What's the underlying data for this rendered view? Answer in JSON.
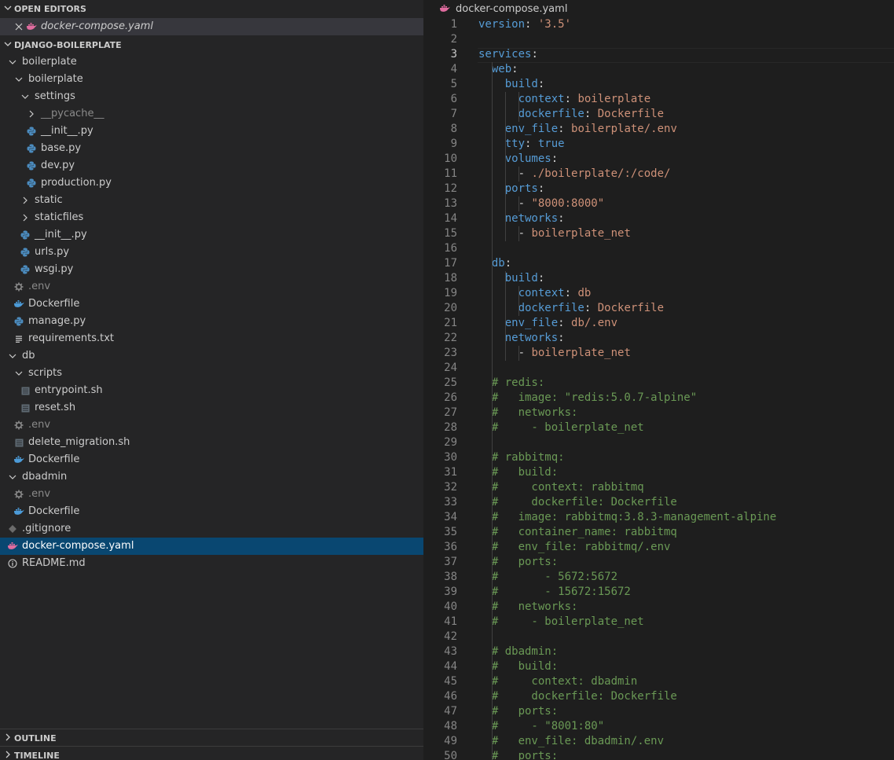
{
  "sidebar": {
    "open_editors_header": "OPEN EDITORS",
    "open_editor_file": "docker-compose.yaml",
    "project_header": "DJANGO-BOILERPLATE",
    "tree": [
      {
        "label": "boilerplate",
        "depth": 0,
        "kind": "folder-open",
        "icon": ""
      },
      {
        "label": "boilerplate",
        "depth": 1,
        "kind": "folder-open",
        "icon": ""
      },
      {
        "label": "settings",
        "depth": 2,
        "kind": "folder-open",
        "icon": ""
      },
      {
        "label": "__pycache__",
        "depth": 3,
        "kind": "folder-closed",
        "icon": "",
        "dim": true
      },
      {
        "label": "__init__.py",
        "depth": 3,
        "kind": "file",
        "icon": "python-icon"
      },
      {
        "label": "base.py",
        "depth": 3,
        "kind": "file",
        "icon": "python-icon"
      },
      {
        "label": "dev.py",
        "depth": 3,
        "kind": "file",
        "icon": "python-icon"
      },
      {
        "label": "production.py",
        "depth": 3,
        "kind": "file",
        "icon": "python-icon"
      },
      {
        "label": "static",
        "depth": 2,
        "kind": "folder-closed",
        "icon": ""
      },
      {
        "label": "staticfiles",
        "depth": 2,
        "kind": "folder-closed",
        "icon": ""
      },
      {
        "label": "__init__.py",
        "depth": 2,
        "kind": "file",
        "icon": "python-icon"
      },
      {
        "label": "urls.py",
        "depth": 2,
        "kind": "file",
        "icon": "python-icon"
      },
      {
        "label": "wsgi.py",
        "depth": 2,
        "kind": "file",
        "icon": "python-icon"
      },
      {
        "label": ".env",
        "depth": 1,
        "kind": "file",
        "icon": "gear-icon",
        "dim": true
      },
      {
        "label": "Dockerfile",
        "depth": 1,
        "kind": "file",
        "icon": "docker-icon"
      },
      {
        "label": "manage.py",
        "depth": 1,
        "kind": "file",
        "icon": "python-icon"
      },
      {
        "label": "requirements.txt",
        "depth": 1,
        "kind": "file",
        "icon": "lines-icon"
      },
      {
        "label": "db",
        "depth": 0,
        "kind": "folder-open",
        "icon": ""
      },
      {
        "label": "scripts",
        "depth": 1,
        "kind": "folder-open",
        "icon": ""
      },
      {
        "label": "entrypoint.sh",
        "depth": 2,
        "kind": "file",
        "icon": "shell-icon"
      },
      {
        "label": "reset.sh",
        "depth": 2,
        "kind": "file",
        "icon": "shell-icon"
      },
      {
        "label": ".env",
        "depth": 1,
        "kind": "file",
        "icon": "gear-icon",
        "dim": true
      },
      {
        "label": "delete_migration.sh",
        "depth": 1,
        "kind": "file",
        "icon": "shell-icon"
      },
      {
        "label": "Dockerfile",
        "depth": 1,
        "kind": "file",
        "icon": "docker-icon"
      },
      {
        "label": "dbadmin",
        "depth": 0,
        "kind": "folder-open",
        "icon": ""
      },
      {
        "label": ".env",
        "depth": 1,
        "kind": "file",
        "icon": "gear-icon",
        "dim": true
      },
      {
        "label": "Dockerfile",
        "depth": 1,
        "kind": "file",
        "icon": "docker-icon"
      },
      {
        "label": ".gitignore",
        "depth": 0,
        "kind": "file",
        "icon": "git-icon"
      },
      {
        "label": "docker-compose.yaml",
        "depth": 0,
        "kind": "file",
        "icon": "docker-icon",
        "selected": true
      },
      {
        "label": "README.md",
        "depth": 0,
        "kind": "file",
        "icon": "info-icon"
      }
    ],
    "outline_header": "OUTLINE",
    "timeline_header": "TIMELINE"
  },
  "editor": {
    "breadcrumb_file": "docker-compose.yaml",
    "lines": [
      {
        "n": "1",
        "t": [
          [
            "k",
            "version"
          ],
          [
            "p",
            ": "
          ],
          [
            "s",
            "'3.5'"
          ]
        ]
      },
      {
        "n": "2",
        "t": []
      },
      {
        "n": "3",
        "t": [
          [
            "k",
            "services"
          ],
          [
            "p",
            ":"
          ]
        ]
      },
      {
        "n": "4",
        "t": [
          [
            "p",
            "  "
          ],
          [
            "k",
            "web"
          ],
          [
            "p",
            ":"
          ]
        ]
      },
      {
        "n": "5",
        "t": [
          [
            "p",
            "    "
          ],
          [
            "k",
            "build"
          ],
          [
            "p",
            ":"
          ]
        ]
      },
      {
        "n": "6",
        "t": [
          [
            "p",
            "      "
          ],
          [
            "k",
            "context"
          ],
          [
            "p",
            ": "
          ],
          [
            "s",
            "boilerplate"
          ]
        ]
      },
      {
        "n": "7",
        "t": [
          [
            "p",
            "      "
          ],
          [
            "k",
            "dockerfile"
          ],
          [
            "p",
            ": "
          ],
          [
            "s",
            "Dockerfile"
          ]
        ]
      },
      {
        "n": "8",
        "t": [
          [
            "p",
            "    "
          ],
          [
            "k",
            "env_file"
          ],
          [
            "p",
            ": "
          ],
          [
            "s",
            "boilerplate/.env"
          ]
        ]
      },
      {
        "n": "9",
        "t": [
          [
            "p",
            "    "
          ],
          [
            "k",
            "tty"
          ],
          [
            "p",
            ": "
          ],
          [
            "b",
            "true"
          ]
        ]
      },
      {
        "n": "10",
        "t": [
          [
            "p",
            "    "
          ],
          [
            "k",
            "volumes"
          ],
          [
            "p",
            ":"
          ]
        ]
      },
      {
        "n": "11",
        "t": [
          [
            "p",
            "      - "
          ],
          [
            "s",
            "./boilerplate/:/code/"
          ]
        ]
      },
      {
        "n": "12",
        "t": [
          [
            "p",
            "    "
          ],
          [
            "k",
            "ports"
          ],
          [
            "p",
            ":"
          ]
        ]
      },
      {
        "n": "13",
        "t": [
          [
            "p",
            "      - "
          ],
          [
            "s",
            "\"8000:8000\""
          ]
        ]
      },
      {
        "n": "14",
        "t": [
          [
            "p",
            "    "
          ],
          [
            "k",
            "networks"
          ],
          [
            "p",
            ":"
          ]
        ]
      },
      {
        "n": "15",
        "t": [
          [
            "p",
            "      - "
          ],
          [
            "s",
            "boilerplate_net"
          ]
        ]
      },
      {
        "n": "16",
        "t": []
      },
      {
        "n": "17",
        "t": [
          [
            "p",
            "  "
          ],
          [
            "k",
            "db"
          ],
          [
            "p",
            ":"
          ]
        ]
      },
      {
        "n": "18",
        "t": [
          [
            "p",
            "    "
          ],
          [
            "k",
            "build"
          ],
          [
            "p",
            ":"
          ]
        ]
      },
      {
        "n": "19",
        "t": [
          [
            "p",
            "      "
          ],
          [
            "k",
            "context"
          ],
          [
            "p",
            ": "
          ],
          [
            "s",
            "db"
          ]
        ]
      },
      {
        "n": "20",
        "t": [
          [
            "p",
            "      "
          ],
          [
            "k",
            "dockerfile"
          ],
          [
            "p",
            ": "
          ],
          [
            "s",
            "Dockerfile"
          ]
        ]
      },
      {
        "n": "21",
        "t": [
          [
            "p",
            "    "
          ],
          [
            "k",
            "env_file"
          ],
          [
            "p",
            ": "
          ],
          [
            "s",
            "db/.env"
          ]
        ]
      },
      {
        "n": "22",
        "t": [
          [
            "p",
            "    "
          ],
          [
            "k",
            "networks"
          ],
          [
            "p",
            ":"
          ]
        ]
      },
      {
        "n": "23",
        "t": [
          [
            "p",
            "      - "
          ],
          [
            "s",
            "boilerplate_net"
          ]
        ]
      },
      {
        "n": "24",
        "t": []
      },
      {
        "n": "25",
        "t": [
          [
            "c",
            "  # redis:"
          ]
        ]
      },
      {
        "n": "26",
        "t": [
          [
            "c",
            "  #   image: \"redis:5.0.7-alpine\""
          ]
        ]
      },
      {
        "n": "27",
        "t": [
          [
            "c",
            "  #   networks:"
          ]
        ]
      },
      {
        "n": "28",
        "t": [
          [
            "c",
            "  #     - boilerplate_net"
          ]
        ]
      },
      {
        "n": "29",
        "t": []
      },
      {
        "n": "30",
        "t": [
          [
            "c",
            "  # rabbitmq:"
          ]
        ]
      },
      {
        "n": "31",
        "t": [
          [
            "c",
            "  #   build:"
          ]
        ]
      },
      {
        "n": "32",
        "t": [
          [
            "c",
            "  #     context: rabbitmq"
          ]
        ]
      },
      {
        "n": "33",
        "t": [
          [
            "c",
            "  #     dockerfile: Dockerfile"
          ]
        ]
      },
      {
        "n": "34",
        "t": [
          [
            "c",
            "  #   image: rabbitmq:3.8.3-management-alpine"
          ]
        ]
      },
      {
        "n": "35",
        "t": [
          [
            "c",
            "  #   container_name: rabbitmq"
          ]
        ]
      },
      {
        "n": "36",
        "t": [
          [
            "c",
            "  #   env_file: rabbitmq/.env"
          ]
        ]
      },
      {
        "n": "37",
        "t": [
          [
            "c",
            "  #   ports:"
          ]
        ]
      },
      {
        "n": "38",
        "t": [
          [
            "c",
            "  #       - 5672:5672"
          ]
        ]
      },
      {
        "n": "39",
        "t": [
          [
            "c",
            "  #       - 15672:15672"
          ]
        ]
      },
      {
        "n": "40",
        "t": [
          [
            "c",
            "  #   networks:"
          ]
        ]
      },
      {
        "n": "41",
        "t": [
          [
            "c",
            "  #     - boilerplate_net"
          ]
        ]
      },
      {
        "n": "42",
        "t": []
      },
      {
        "n": "43",
        "t": [
          [
            "c",
            "  # dbadmin:"
          ]
        ]
      },
      {
        "n": "44",
        "t": [
          [
            "c",
            "  #   build:"
          ]
        ]
      },
      {
        "n": "45",
        "t": [
          [
            "c",
            "  #     context: dbadmin"
          ]
        ]
      },
      {
        "n": "46",
        "t": [
          [
            "c",
            "  #     dockerfile: Dockerfile"
          ]
        ]
      },
      {
        "n": "47",
        "t": [
          [
            "c",
            "  #   ports:"
          ]
        ]
      },
      {
        "n": "48",
        "t": [
          [
            "c",
            "  #     - \"8001:80\""
          ]
        ]
      },
      {
        "n": "49",
        "t": [
          [
            "c",
            "  #   env_file: dbadmin/.env"
          ]
        ]
      },
      {
        "n": "50",
        "t": [
          [
            "c",
            "  #   ports:"
          ]
        ]
      }
    ]
  },
  "colors": {
    "sidebar_bg": "#252526",
    "editor_bg": "#1e1e1e",
    "selection": "#094771",
    "python": "#4b8bbe",
    "docker": "#e06c9f",
    "gear": "#8a8a8a"
  }
}
